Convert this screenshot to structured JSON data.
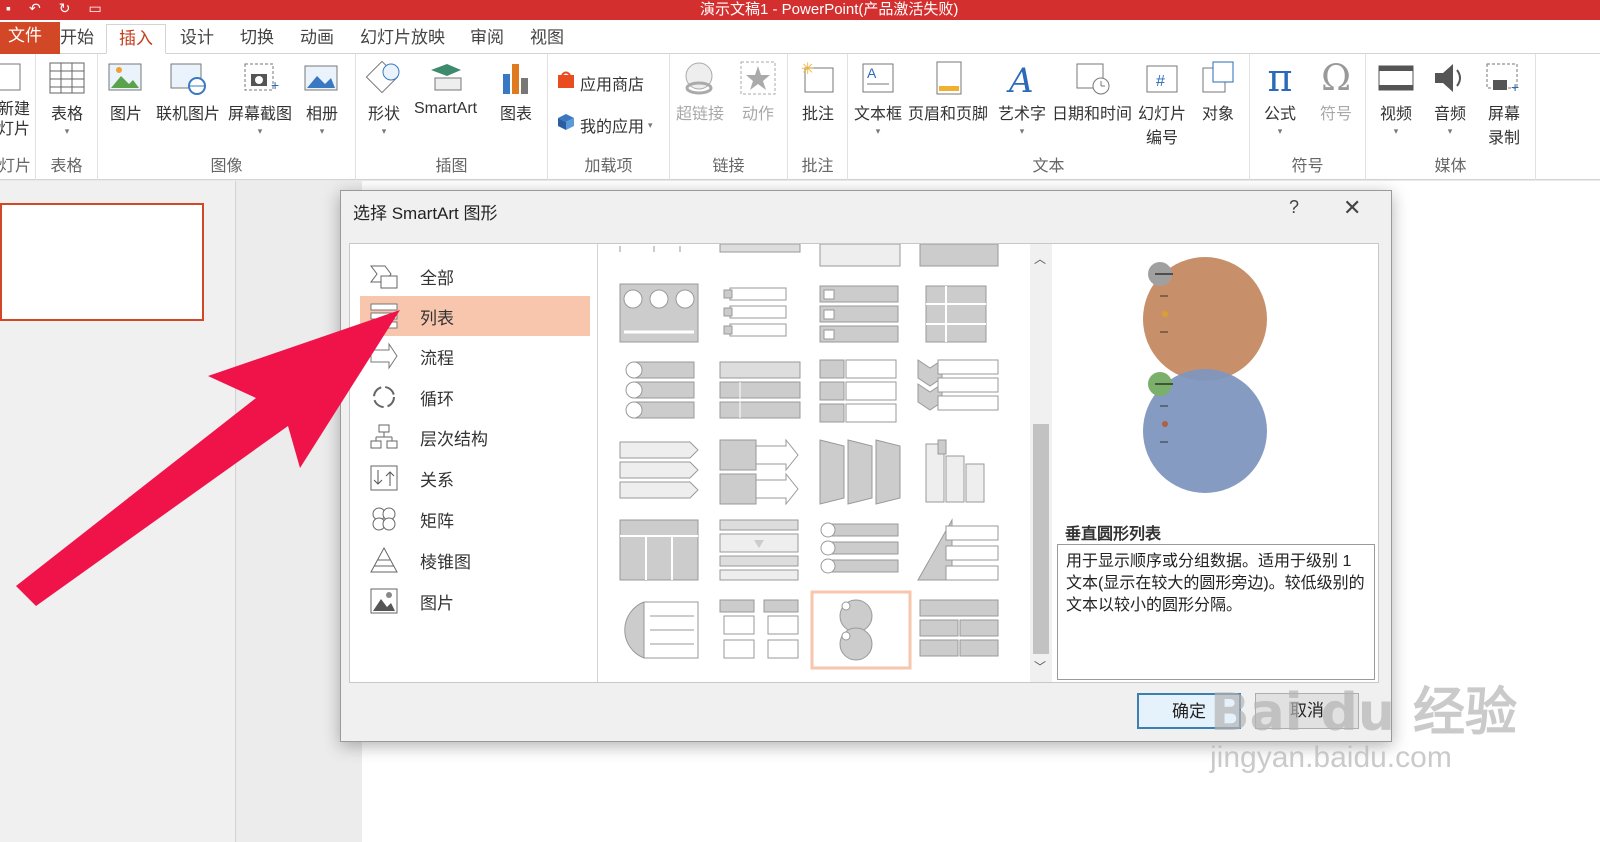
{
  "window": {
    "title": "演示文稿1 - PowerPoint(产品激活失败)"
  },
  "tabs": [
    {
      "label": "文件"
    },
    {
      "label": "开始"
    },
    {
      "label": "插入"
    },
    {
      "label": "设计"
    },
    {
      "label": "切换"
    },
    {
      "label": "动画"
    },
    {
      "label": "幻灯片放映"
    },
    {
      "label": "审阅"
    },
    {
      "label": "视图"
    }
  ],
  "ribbon": {
    "slides": {
      "button": "新建\n幻灯片",
      "group": "幻灯片"
    },
    "tables": {
      "button": "表格",
      "group": "表格"
    },
    "images": {
      "pic": "图片",
      "online": "联机图片",
      "screenshot": "屏幕截图",
      "album": "相册",
      "group": "图像"
    },
    "illustrations": {
      "shapes": "形状",
      "smartart": "SmartArt",
      "chart": "图表",
      "group": "插图"
    },
    "addins": {
      "store": "应用商店",
      "myapps": "我的应用",
      "group": "加载项"
    },
    "links": {
      "hyperlink": "超链接",
      "action": "动作",
      "group": "链接"
    },
    "comments": {
      "comment": "批注",
      "group": "批注"
    },
    "text": {
      "textbox": "文本框",
      "headerfooter": "页眉和页脚",
      "wordart": "艺术字",
      "datetime": "日期和时间",
      "slidenum_1": "幻灯片",
      "slidenum_2": "编号",
      "object": "对象",
      "group": "文本"
    },
    "symbols": {
      "equation": "公式",
      "symbol": "符号",
      "group": "符号"
    },
    "media": {
      "video": "视频",
      "audio": "音频",
      "screenrec_1": "屏幕",
      "screenrec_2": "录制",
      "group": "媒体"
    }
  },
  "dialog": {
    "title": "选择 SmartArt 图形",
    "help": "?",
    "categories": [
      {
        "label": "全部",
        "icon": "all-icon"
      },
      {
        "label": "列表",
        "icon": "list-icon"
      },
      {
        "label": "流程",
        "icon": "process-icon"
      },
      {
        "label": "循环",
        "icon": "cycle-icon"
      },
      {
        "label": "层次结构",
        "icon": "hierarchy-icon"
      },
      {
        "label": "关系",
        "icon": "relationship-icon"
      },
      {
        "label": "矩阵",
        "icon": "matrix-icon"
      },
      {
        "label": "棱锥图",
        "icon": "pyramid-icon"
      },
      {
        "label": "图片",
        "icon": "picture-icon"
      }
    ],
    "selected_category": "列表",
    "preview_name": "垂直圆形列表",
    "preview_desc": "用于显示顺序或分组数据。适用于级别 1 文本(显示在较大的圆形旁边)。较低级别的文本以较小的圆形分隔。",
    "ok": "确定",
    "cancel": "取消"
  },
  "watermark": {
    "logo": "Bai du 经验",
    "url": "jingyan.baidu.com"
  },
  "colors": {
    "accent": "#d24726",
    "title_bar": "#d32f2f",
    "selection": "#f7c6ac",
    "arrow": "#f0134a"
  }
}
